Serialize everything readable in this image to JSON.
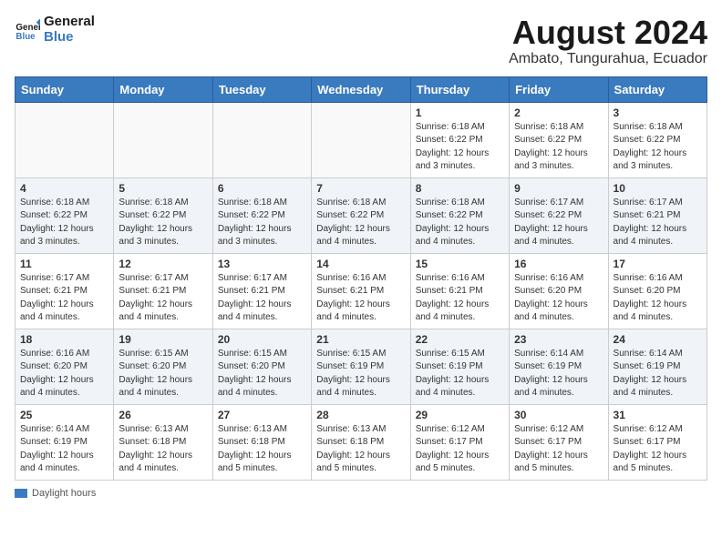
{
  "header": {
    "logo_line1": "General",
    "logo_line2": "Blue",
    "title": "August 2024",
    "subtitle": "Ambato, Tungurahua, Ecuador"
  },
  "weekdays": [
    "Sunday",
    "Monday",
    "Tuesday",
    "Wednesday",
    "Thursday",
    "Friday",
    "Saturday"
  ],
  "weeks": [
    [
      {
        "day": "",
        "info": ""
      },
      {
        "day": "",
        "info": ""
      },
      {
        "day": "",
        "info": ""
      },
      {
        "day": "",
        "info": ""
      },
      {
        "day": "1",
        "info": "Sunrise: 6:18 AM\nSunset: 6:22 PM\nDaylight: 12 hours\nand 3 minutes."
      },
      {
        "day": "2",
        "info": "Sunrise: 6:18 AM\nSunset: 6:22 PM\nDaylight: 12 hours\nand 3 minutes."
      },
      {
        "day": "3",
        "info": "Sunrise: 6:18 AM\nSunset: 6:22 PM\nDaylight: 12 hours\nand 3 minutes."
      }
    ],
    [
      {
        "day": "4",
        "info": "Sunrise: 6:18 AM\nSunset: 6:22 PM\nDaylight: 12 hours\nand 3 minutes."
      },
      {
        "day": "5",
        "info": "Sunrise: 6:18 AM\nSunset: 6:22 PM\nDaylight: 12 hours\nand 3 minutes."
      },
      {
        "day": "6",
        "info": "Sunrise: 6:18 AM\nSunset: 6:22 PM\nDaylight: 12 hours\nand 3 minutes."
      },
      {
        "day": "7",
        "info": "Sunrise: 6:18 AM\nSunset: 6:22 PM\nDaylight: 12 hours\nand 4 minutes."
      },
      {
        "day": "8",
        "info": "Sunrise: 6:18 AM\nSunset: 6:22 PM\nDaylight: 12 hours\nand 4 minutes."
      },
      {
        "day": "9",
        "info": "Sunrise: 6:17 AM\nSunset: 6:22 PM\nDaylight: 12 hours\nand 4 minutes."
      },
      {
        "day": "10",
        "info": "Sunrise: 6:17 AM\nSunset: 6:21 PM\nDaylight: 12 hours\nand 4 minutes."
      }
    ],
    [
      {
        "day": "11",
        "info": "Sunrise: 6:17 AM\nSunset: 6:21 PM\nDaylight: 12 hours\nand 4 minutes."
      },
      {
        "day": "12",
        "info": "Sunrise: 6:17 AM\nSunset: 6:21 PM\nDaylight: 12 hours\nand 4 minutes."
      },
      {
        "day": "13",
        "info": "Sunrise: 6:17 AM\nSunset: 6:21 PM\nDaylight: 12 hours\nand 4 minutes."
      },
      {
        "day": "14",
        "info": "Sunrise: 6:16 AM\nSunset: 6:21 PM\nDaylight: 12 hours\nand 4 minutes."
      },
      {
        "day": "15",
        "info": "Sunrise: 6:16 AM\nSunset: 6:21 PM\nDaylight: 12 hours\nand 4 minutes."
      },
      {
        "day": "16",
        "info": "Sunrise: 6:16 AM\nSunset: 6:20 PM\nDaylight: 12 hours\nand 4 minutes."
      },
      {
        "day": "17",
        "info": "Sunrise: 6:16 AM\nSunset: 6:20 PM\nDaylight: 12 hours\nand 4 minutes."
      }
    ],
    [
      {
        "day": "18",
        "info": "Sunrise: 6:16 AM\nSunset: 6:20 PM\nDaylight: 12 hours\nand 4 minutes."
      },
      {
        "day": "19",
        "info": "Sunrise: 6:15 AM\nSunset: 6:20 PM\nDaylight: 12 hours\nand 4 minutes."
      },
      {
        "day": "20",
        "info": "Sunrise: 6:15 AM\nSunset: 6:20 PM\nDaylight: 12 hours\nand 4 minutes."
      },
      {
        "day": "21",
        "info": "Sunrise: 6:15 AM\nSunset: 6:19 PM\nDaylight: 12 hours\nand 4 minutes."
      },
      {
        "day": "22",
        "info": "Sunrise: 6:15 AM\nSunset: 6:19 PM\nDaylight: 12 hours\nand 4 minutes."
      },
      {
        "day": "23",
        "info": "Sunrise: 6:14 AM\nSunset: 6:19 PM\nDaylight: 12 hours\nand 4 minutes."
      },
      {
        "day": "24",
        "info": "Sunrise: 6:14 AM\nSunset: 6:19 PM\nDaylight: 12 hours\nand 4 minutes."
      }
    ],
    [
      {
        "day": "25",
        "info": "Sunrise: 6:14 AM\nSunset: 6:19 PM\nDaylight: 12 hours\nand 4 minutes."
      },
      {
        "day": "26",
        "info": "Sunrise: 6:13 AM\nSunset: 6:18 PM\nDaylight: 12 hours\nand 4 minutes."
      },
      {
        "day": "27",
        "info": "Sunrise: 6:13 AM\nSunset: 6:18 PM\nDaylight: 12 hours\nand 5 minutes."
      },
      {
        "day": "28",
        "info": "Sunrise: 6:13 AM\nSunset: 6:18 PM\nDaylight: 12 hours\nand 5 minutes."
      },
      {
        "day": "29",
        "info": "Sunrise: 6:12 AM\nSunset: 6:17 PM\nDaylight: 12 hours\nand 5 minutes."
      },
      {
        "day": "30",
        "info": "Sunrise: 6:12 AM\nSunset: 6:17 PM\nDaylight: 12 hours\nand 5 minutes."
      },
      {
        "day": "31",
        "info": "Sunrise: 6:12 AM\nSunset: 6:17 PM\nDaylight: 12 hours\nand 5 minutes."
      }
    ]
  ],
  "footer": {
    "daylight_label": "Daylight hours"
  }
}
